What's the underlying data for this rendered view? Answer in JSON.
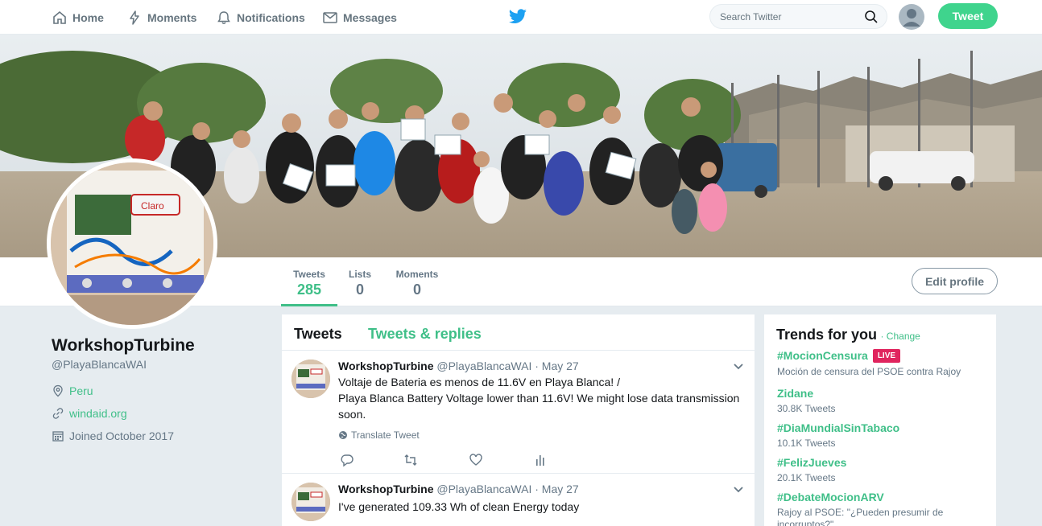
{
  "nav": {
    "home": "Home",
    "moments": "Moments",
    "notifications": "Notifications",
    "messages": "Messages",
    "search_placeholder": "Search Twitter",
    "tweet_button": "Tweet"
  },
  "profile": {
    "name": "WorkshopTurbine",
    "handle": "@PlayaBlancaWAI",
    "location": "Peru",
    "website": "windaid.org",
    "joined": "Joined October 2017",
    "edit_button": "Edit profile",
    "stats": [
      {
        "label": "Tweets",
        "value": "285"
      },
      {
        "label": "Lists",
        "value": "0"
      },
      {
        "label": "Moments",
        "value": "0"
      }
    ]
  },
  "timeline": {
    "tab_tweets": "Tweets",
    "tab_replies": "Tweets & replies",
    "tweets": [
      {
        "name": "WorkshopTurbine",
        "handle": "@PlayaBlancaWAI",
        "date": "· May 27",
        "line1": "Voltaje de Bateria es menos de 11.6V en Playa Blanca! /",
        "line2": "Playa Blanca Battery Voltage lower than 11.6V! We might lose data transmission",
        "line3": "soon.",
        "translate": "Translate Tweet"
      },
      {
        "name": "WorkshopTurbine",
        "handle": "@PlayaBlancaWAI",
        "date": "· May 27",
        "line1": "I've generated 109.33  Wh of clean Energy today"
      }
    ]
  },
  "trends": {
    "title": "Trends for you",
    "change": "· Change",
    "live_badge": "LIVE",
    "items": [
      {
        "name": "#MocionCensura",
        "sub": "Moción de censura del PSOE contra Rajoy"
      },
      {
        "name": "Zidane",
        "sub": "30.8K Tweets"
      },
      {
        "name": "#DiaMundialSinTabaco",
        "sub": "10.1K Tweets"
      },
      {
        "name": "#FelizJueves",
        "sub": "20.1K Tweets"
      },
      {
        "name": "#DebateMocionARV",
        "sub": "Rajoy al PSOE: \"¿Pueden presumir de incorruptos?\""
      }
    ]
  },
  "colors": {
    "accent": "#3fbf88",
    "tweet_button": "#3fd48d",
    "live": "#e0245e",
    "twitter_blue": "#1da1f2"
  }
}
